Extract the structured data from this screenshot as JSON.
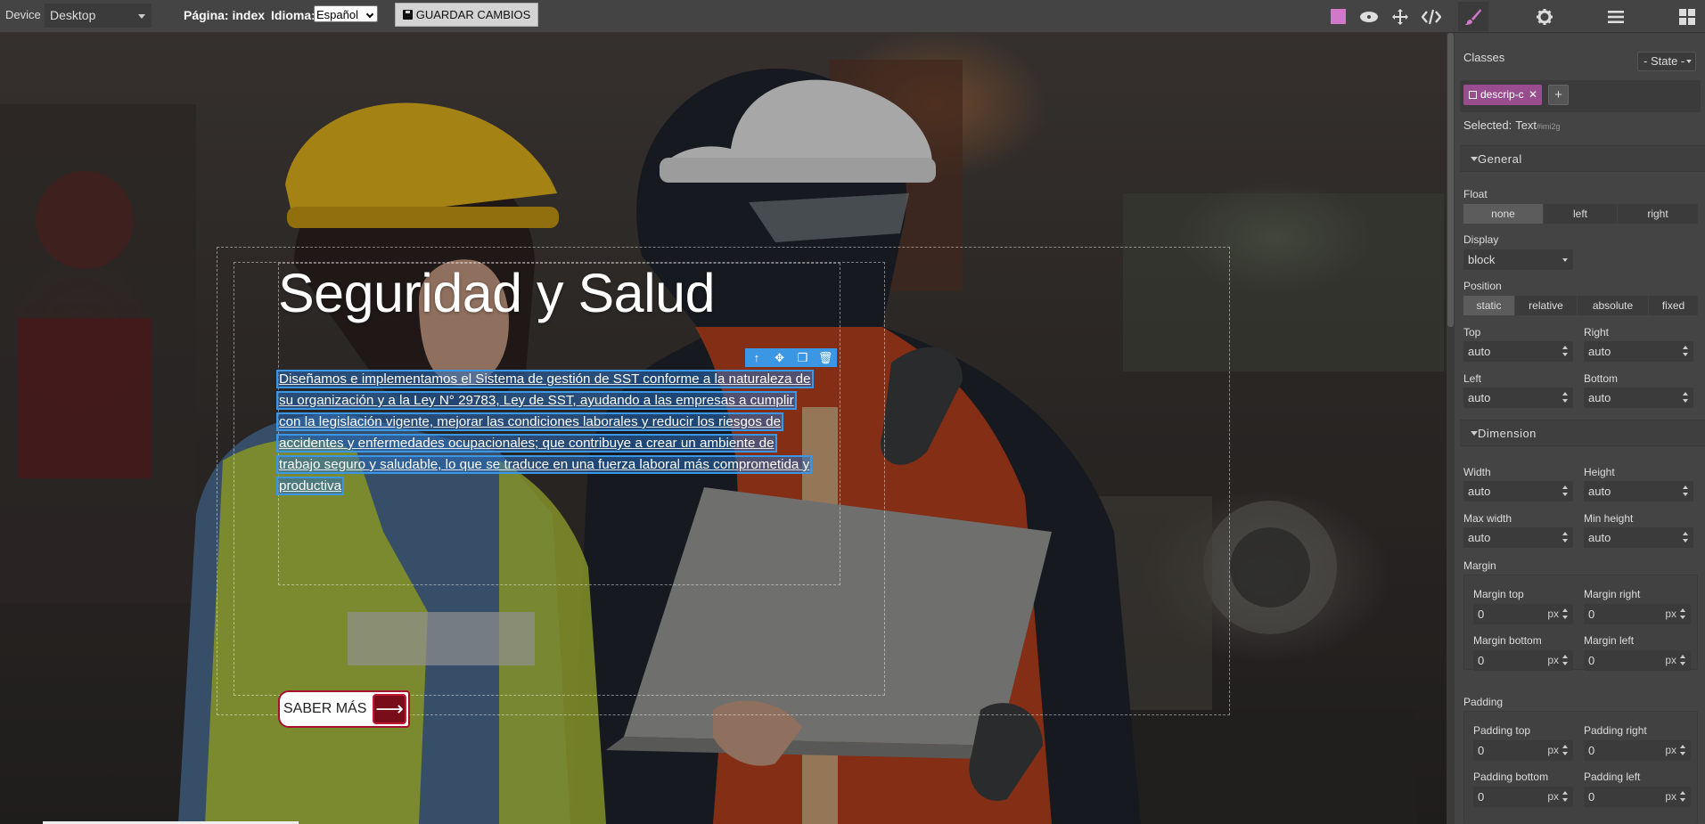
{
  "topbar": {
    "device_label": "Device",
    "device_value": "Desktop",
    "page_label": "Página:",
    "page_value": "index",
    "language_label": "Idioma:",
    "language_value": "Español",
    "save_button": "GUARDAR CAMBIOS",
    "icons": [
      "square-icon",
      "eye-icon",
      "move-icon",
      "code-icon",
      "brush-icon",
      "gear-icon",
      "bars-icon",
      "blocks-icon"
    ]
  },
  "canvas": {
    "hero_title": "Seguridad y Salud",
    "hero_description_lines": [
      "Diseñamos e implementamos el Sistema de gestión de SST conforme a la naturaleza de",
      "su organización y a la Ley N° 29783, Ley de SST, ayudando a las empresas a cumplir",
      "con la legislación vigente, mejorar las condiciones laborales y reducir los riesgos de",
      "accidentes y enfermedades ocupacionales; que contribuye a crear un ambiente de",
      "trabajo seguro y saludable, lo que se traduce en una fuerza laboral más comprometida y",
      "productiva"
    ],
    "cta_label": "SABER MÁS",
    "cta_arrow": "⟶",
    "mini_toolbar": [
      "↑",
      "✥",
      "❐",
      "🗑"
    ]
  },
  "panel": {
    "classes_label": "Classes",
    "state_select": "- State -",
    "class_tag": "descrip-c",
    "add_tag": "+",
    "selected_label": "Selected:",
    "selected_value": "Text",
    "selected_id": "#imi2g",
    "general": {
      "heading": "General",
      "float_label": "Float",
      "float_options": [
        "none",
        "left",
        "right"
      ],
      "display_label": "Display",
      "display_value": "block",
      "position_label": "Position",
      "position_options": [
        "static",
        "relative",
        "absolute",
        "fixed"
      ],
      "top_label": "Top",
      "top_value": "auto",
      "right_label": "Right",
      "right_value": "auto",
      "left_label": "Left",
      "left_value": "auto",
      "bottom_label": "Bottom",
      "bottom_value": "auto"
    },
    "dimension": {
      "heading": "Dimension",
      "width_label": "Width",
      "width_value": "auto",
      "height_label": "Height",
      "height_value": "auto",
      "max_width_label": "Max width",
      "max_width_value": "auto",
      "min_height_label": "Min height",
      "min_height_value": "auto",
      "margin_label": "Margin",
      "margin_top_label": "Margin top",
      "margin_top_value": "0",
      "margin_right_label": "Margin right",
      "margin_right_value": "0",
      "margin_bottom_label": "Margin bottom",
      "margin_bottom_value": "0",
      "margin_left_label": "Margin left",
      "margin_left_value": "0",
      "padding_label": "Padding",
      "padding_top_label": "Padding top",
      "padding_top_value": "0",
      "padding_right_label": "Padding right",
      "padding_right_value": "0",
      "padding_bottom_label": "Padding bottom",
      "padding_bottom_value": "0",
      "padding_left_label": "Padding left",
      "padding_left_value": "0",
      "unit": "px"
    }
  }
}
